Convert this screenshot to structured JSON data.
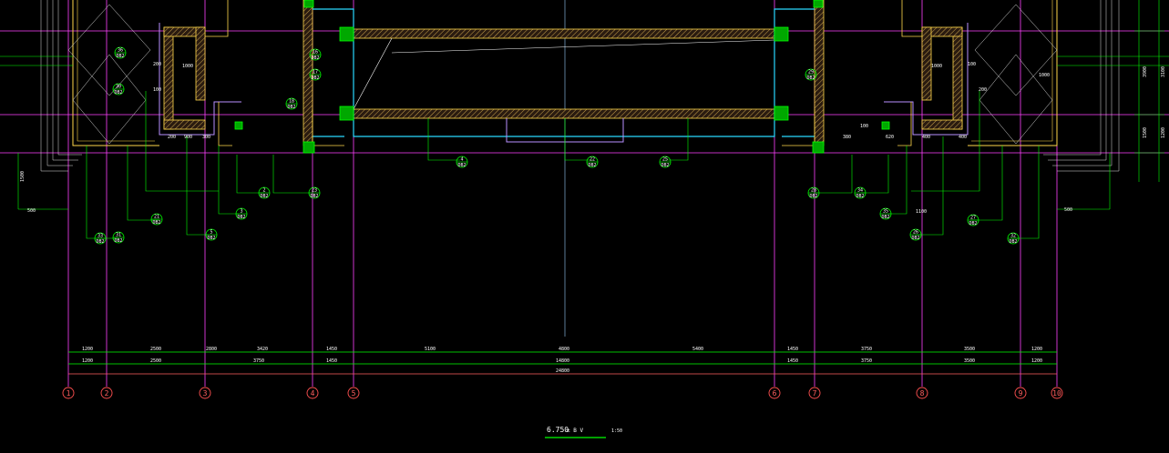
{
  "drawing": {
    "title": "6.750",
    "title_suffix": "±  B  V",
    "scale": "1:50",
    "colors": {
      "background": "#000000",
      "wall": "#ffd84a",
      "hatch": "#c8a24b",
      "grid_axis": "#ff40ff",
      "dimension": "#00ff00",
      "slab": "#29d9ff",
      "partition": "#b890ff",
      "column": "#00c000",
      "axis_bubble": "#ff5050"
    }
  },
  "axes": {
    "labels": [
      "1",
      "2",
      "3",
      "4",
      "5",
      "6",
      "7",
      "8",
      "9",
      "10"
    ]
  },
  "dimensions": {
    "row1": [
      "1200",
      "2500",
      "2800",
      "3420",
      "1450",
      "5100",
      "4800",
      "5400",
      "1450",
      "3750",
      "3500",
      "1200"
    ],
    "row2": [
      "1200",
      "2500",
      "3750",
      "1450",
      "14800",
      "1450",
      "3750",
      "3500",
      "1200"
    ],
    "overall": "24800"
  },
  "side_dims": {
    "right": [
      "3900",
      "1500",
      "3100",
      "1200"
    ],
    "left": [
      "1500",
      "500"
    ]
  },
  "tags": [
    {
      "num": "31",
      "code": "DB2"
    },
    {
      "num": "21",
      "code": "DB2"
    },
    {
      "num": "5",
      "code": "DB2"
    },
    {
      "num": "3",
      "code": "DB2"
    },
    {
      "num": "2",
      "code": "DB2"
    },
    {
      "num": "23",
      "code": "DB2"
    },
    {
      "num": "4",
      "code": "DB2"
    },
    {
      "num": "22",
      "code": "DB2"
    },
    {
      "num": "25",
      "code": "DB2"
    },
    {
      "num": "18",
      "code": "DB2"
    },
    {
      "num": "17",
      "code": "DB2"
    },
    {
      "num": "16",
      "code": "DB2"
    },
    {
      "num": "30",
      "code": "DB2"
    },
    {
      "num": "36",
      "code": "DB2"
    },
    {
      "num": "33",
      "code": "DB2"
    },
    {
      "num": "32",
      "code": "DB2"
    },
    {
      "num": "27",
      "code": "DB2"
    },
    {
      "num": "26",
      "code": "DB2"
    },
    {
      "num": "35",
      "code": "DB2"
    },
    {
      "num": "34",
      "code": "DB2"
    },
    {
      "num": "28",
      "code": "DB2"
    },
    {
      "num": "29",
      "code": "DB2"
    }
  ],
  "notes": {
    "local_dims": [
      "200",
      "1000",
      "100",
      "200",
      "900",
      "300",
      "1000",
      "100",
      "400",
      "620",
      "400",
      "1000",
      "200",
      "380",
      "100",
      "1100",
      "500"
    ]
  }
}
